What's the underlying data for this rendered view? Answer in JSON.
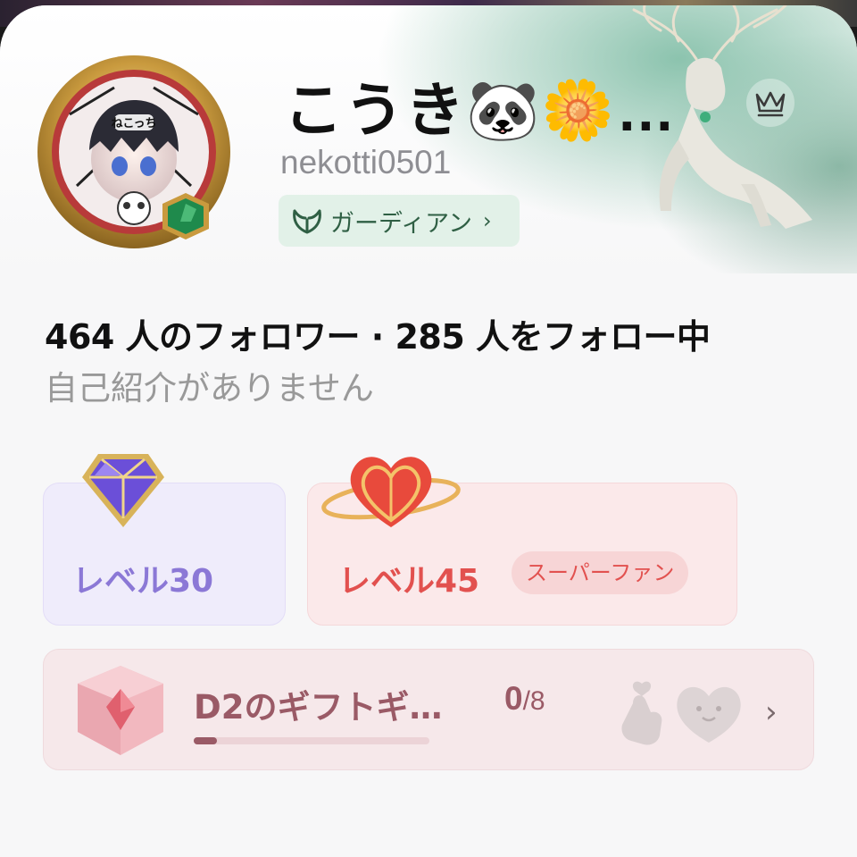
{
  "profile": {
    "display_name": "こうき🐼🌼…",
    "username": "nekotti0501",
    "avatar_tag": "ねこっち",
    "badge_label": "ガーディアン",
    "badge_chevron": "›"
  },
  "stats": {
    "follow_line": "464 人のフォロワー · 285 人をフォロー中",
    "bio": "自己紹介がありません"
  },
  "levels": {
    "purple": {
      "label": "レベル30"
    },
    "red": {
      "label": "レベル45",
      "tag": "スーパーファン"
    }
  },
  "gift": {
    "title": "D2のギフトギ…",
    "current": "0",
    "total": "/8",
    "progress": 0.1,
    "chevron": "›"
  },
  "colors": {
    "level_purple": "#8b78d6",
    "level_red": "#e2514f",
    "guardian_green": "#2f5f44",
    "gift_text": "#9a5a66"
  },
  "icons": [
    "crown-icon",
    "guardian-antlers-icon",
    "purple-gem-icon",
    "heart-planet-icon",
    "pink-gem-cube-icon",
    "finger-heart-icon",
    "heart-blob-icon",
    "chevron-right-icon"
  ]
}
